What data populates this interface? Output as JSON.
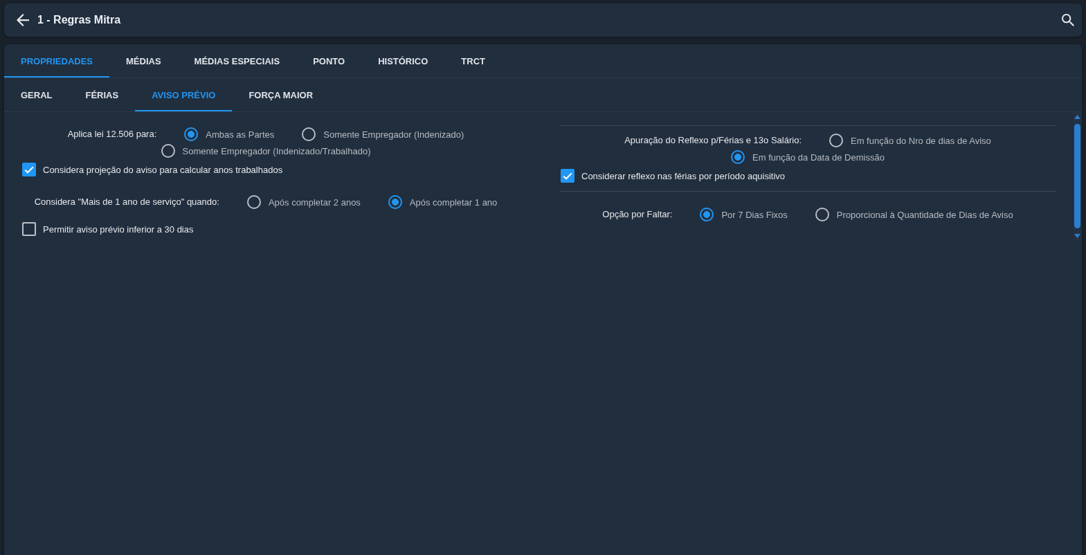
{
  "header": {
    "title": "1 - Regras Mitra"
  },
  "tabs": [
    {
      "label": "PROPRIEDADES",
      "selected": true
    },
    {
      "label": "MÉDIAS",
      "selected": false
    },
    {
      "label": "MÉDIAS ESPECIAIS",
      "selected": false
    },
    {
      "label": "PONTO",
      "selected": false
    },
    {
      "label": "HISTÓRICO",
      "selected": false
    },
    {
      "label": "TRCT",
      "selected": false
    }
  ],
  "subtabs": [
    {
      "label": "GERAL",
      "selected": false
    },
    {
      "label": "FÉRIAS",
      "selected": false
    },
    {
      "label": "AVISO PRÉVIO",
      "selected": true
    },
    {
      "label": "FORÇA MAIOR",
      "selected": false
    }
  ],
  "left_column": {
    "fields": [
      {
        "kind": "radio",
        "label": "Aplica lei 12.506 para:",
        "options": [
          {
            "label": "Ambas as Partes",
            "selected": true
          },
          {
            "label": "Somente Empregador (Indenizado)",
            "selected": false
          },
          {
            "label": "Somente Empregador (Indenizado/Trabalhado)",
            "selected": false
          }
        ]
      },
      {
        "kind": "checkbox",
        "label": "Considera projeção do aviso para calcular anos trabalhados",
        "checked": true
      },
      {
        "kind": "radio",
        "label": "Considera \"Mais de 1 ano de serviço\" quando:",
        "options": [
          {
            "label": "Após completar 2 anos",
            "selected": false
          },
          {
            "label": "Após completar 1 ano",
            "selected": true
          }
        ]
      },
      {
        "kind": "checkbox",
        "label": "Permitir aviso prévio inferior a 30 dias",
        "checked": false
      }
    ]
  },
  "right_column": {
    "sections": [
      {
        "fields": [
          {
            "kind": "radio",
            "label": "Apuração do Reflexo p/Férias e 13o Salário:",
            "options": [
              {
                "label": "Em função do Nro de dias de Aviso",
                "selected": false
              },
              {
                "label": "Em função da Data de Demissão",
                "selected": true
              }
            ]
          },
          {
            "kind": "checkbox",
            "label": "Considerar reflexo nas férias por período aquisitivo",
            "checked": true
          }
        ]
      },
      {
        "fields": [
          {
            "kind": "radio",
            "label": "Opção por Faltar:",
            "options": [
              {
                "label": "Por 7 Dias Fixos",
                "selected": true
              },
              {
                "label": "Proporcional à Quantidade de Dias de Aviso",
                "selected": false
              }
            ]
          }
        ]
      }
    ]
  }
}
